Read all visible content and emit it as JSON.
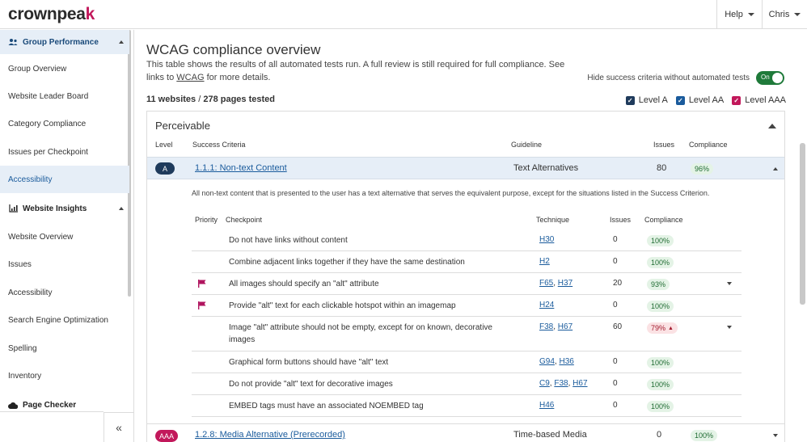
{
  "header": {
    "logo_pre": "crownpea",
    "logo_k": "k",
    "help_label": "Help",
    "user_label": "Chris"
  },
  "sidebar": {
    "groups": [
      {
        "label": "Group Performance",
        "icon": "users-icon"
      },
      {
        "label": "Website Insights",
        "icon": "bar-chart-icon"
      },
      {
        "label": "Page Checker",
        "icon": "cloud-icon"
      }
    ],
    "items": [
      {
        "label": "Group Overview"
      },
      {
        "label": "Website Leader Board"
      },
      {
        "label": "Category Compliance"
      },
      {
        "label": "Issues per Checkpoint"
      },
      {
        "label": "Accessibility"
      },
      {
        "label": "Website Overview"
      },
      {
        "label": "Issues"
      },
      {
        "label": "Accessibility"
      },
      {
        "label": "Search Engine Optimization"
      },
      {
        "label": "Spelling"
      },
      {
        "label": "Inventory"
      }
    ],
    "collapse_glyph": "«"
  },
  "main": {
    "title": "WCAG compliance overview",
    "desc_1": "This table shows the results of all automated tests run. A full review is still required for full compliance. See",
    "desc_2a": "links to ",
    "desc_2b": "WCAG",
    "desc_2c": " for more details.",
    "toggle_label": "Hide success criteria without automated tests",
    "toggle_state": "On",
    "tested_a": "11 websites",
    "tested_sep": " / ",
    "tested_b": "278 pages tested",
    "levels": [
      {
        "label": "Level A",
        "color": "#1f3b5c",
        "checked": true
      },
      {
        "label": "Level AA",
        "color": "#1a5b9c",
        "checked": true
      },
      {
        "label": "Level AAA",
        "color": "#c2185b",
        "checked": true
      }
    ]
  },
  "panel": {
    "title": "Perceivable",
    "headers": {
      "level": "Level",
      "criteria": "Success Criteria",
      "guideline": "Guideline",
      "issues": "Issues",
      "compliance": "Compliance"
    },
    "criterion": {
      "level": "A",
      "level_color": "#1f3b5c",
      "link": "1.1.1: Non-text Content",
      "guideline": "Text Alternatives",
      "issues": "80",
      "compliance": "96%",
      "description": "All non-text content that is presented to the user has a text alternative that serves the equivalent purpose, except for the situations listed in the Success Criterion."
    },
    "checkpoint_headers": {
      "priority": "Priority",
      "checkpoint": "Checkpoint",
      "technique": "Technique",
      "issues": "Issues",
      "compliance": "Compliance"
    },
    "checkpoints": [
      {
        "text": "Do not have links without content",
        "techniques": [
          "H30"
        ],
        "issues": "0",
        "compliance": "100%",
        "flag": false
      },
      {
        "text": "Combine adjacent links together if they have the same destination",
        "techniques": [
          "H2"
        ],
        "issues": "0",
        "compliance": "100%",
        "flag": false
      },
      {
        "text": "All images should specify an \"alt\" attribute",
        "techniques": [
          "F65",
          "H37"
        ],
        "issues": "20",
        "compliance": "93%",
        "flag": true
      },
      {
        "text": "Provide \"alt\" text for each clickable hotspot within an imagemap",
        "techniques": [
          "H24"
        ],
        "issues": "0",
        "compliance": "100%",
        "flag": true
      },
      {
        "text": "Image \"alt\" attribute should not be empty, except for on known, decorative images",
        "techniques": [
          "F38",
          "H67"
        ],
        "issues": "60",
        "compliance": "79%",
        "flag": false
      },
      {
        "text": "Graphical form buttons should have \"alt\" text",
        "techniques": [
          "G94",
          "H36"
        ],
        "issues": "0",
        "compliance": "100%",
        "flag": false
      },
      {
        "text": "Do not provide \"alt\" text for decorative images",
        "techniques": [
          "C9",
          "F38",
          "H67"
        ],
        "issues": "0",
        "compliance": "100%",
        "flag": false
      },
      {
        "text": "EMBED tags must have an associated NOEMBED tag",
        "techniques": [
          "H46"
        ],
        "issues": "0",
        "compliance": "100%",
        "flag": false
      }
    ],
    "criterion2": {
      "level": "AAA",
      "level_color": "#c2185b",
      "link": "1.2.8: Media Alternative (Prerecorded)",
      "guideline": "Time-based Media",
      "issues": "0",
      "compliance": "100%"
    },
    "sep": ", ",
    "flag_color": "#b0155f"
  }
}
